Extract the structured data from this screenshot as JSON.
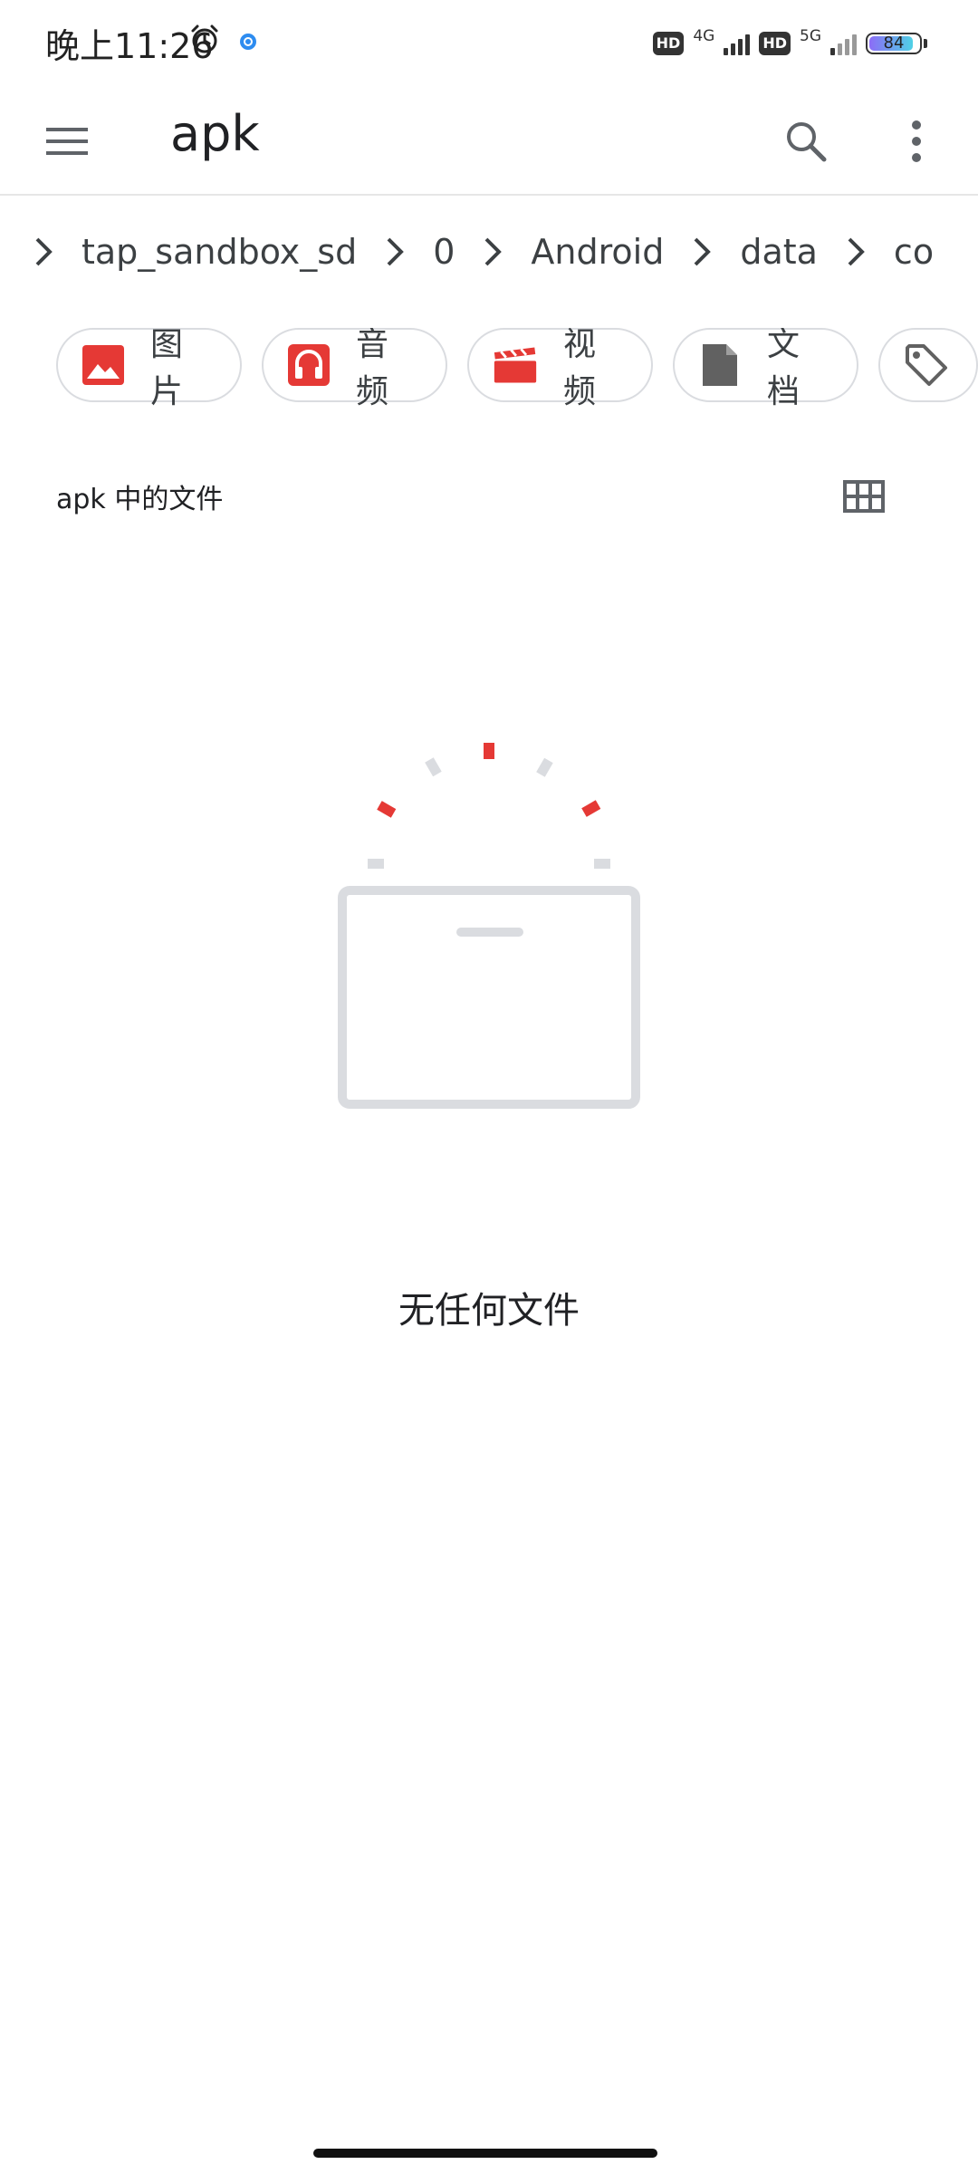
{
  "status_bar": {
    "time": "晚上11:26",
    "hd1": "HD",
    "net1": "4G",
    "hd2": "HD",
    "net2": "5G",
    "battery": "84",
    "icons": [
      "alarm-icon",
      "app-notification-dot-icon",
      "signal-icon",
      "battery-icon"
    ]
  },
  "app_bar": {
    "title": "apk",
    "icons": [
      "menu-icon",
      "search-icon",
      "more-vert-icon"
    ]
  },
  "breadcrumb": [
    "tap_sandbox_sd",
    "0",
    "Android",
    "data",
    "co"
  ],
  "chips": [
    {
      "label": "图片",
      "icon": "image-icon",
      "color": "#e53935"
    },
    {
      "label": "音频",
      "icon": "headphones-icon",
      "color": "#e53935"
    },
    {
      "label": "视频",
      "icon": "clapperboard-icon",
      "color": "#e53935"
    },
    {
      "label": "文档",
      "icon": "document-icon",
      "color": "#616161"
    },
    {
      "label": "",
      "icon": "tag-icon",
      "color": "#616161"
    }
  ],
  "section": {
    "title": "apk 中的文件",
    "view_toggle_icon": "grid-view-icon"
  },
  "empty_state": {
    "message": "无任何文件",
    "accent_color": "#e53935",
    "muted_color": "#dadce0"
  }
}
